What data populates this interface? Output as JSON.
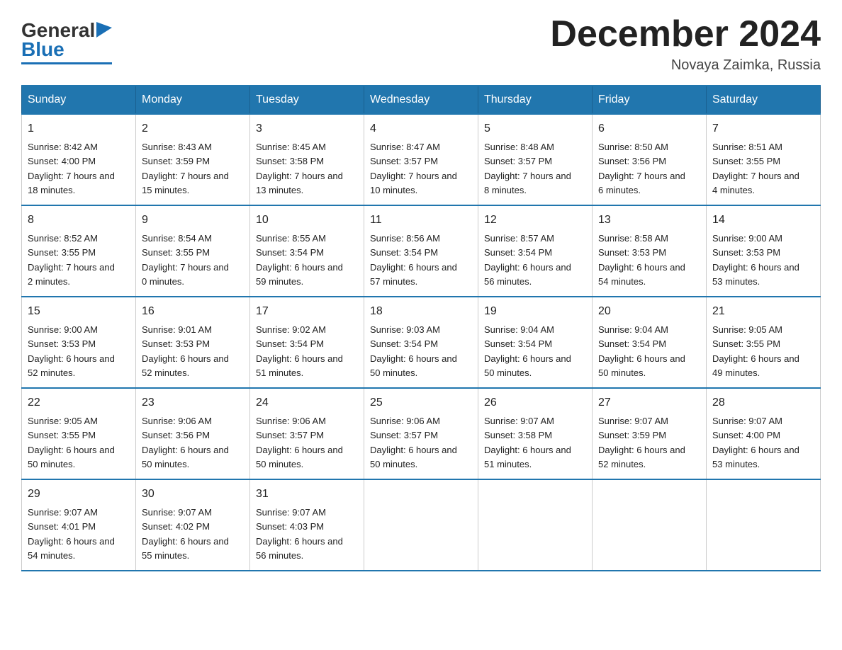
{
  "header": {
    "logo_text_general": "General",
    "logo_text_blue": "Blue",
    "month_title": "December 2024",
    "location": "Novaya Zaimka, Russia"
  },
  "days_of_week": [
    "Sunday",
    "Monday",
    "Tuesday",
    "Wednesday",
    "Thursday",
    "Friday",
    "Saturday"
  ],
  "weeks": [
    [
      {
        "day": "1",
        "sunrise": "8:42 AM",
        "sunset": "4:00 PM",
        "daylight": "7 hours and 18 minutes."
      },
      {
        "day": "2",
        "sunrise": "8:43 AM",
        "sunset": "3:59 PM",
        "daylight": "7 hours and 15 minutes."
      },
      {
        "day": "3",
        "sunrise": "8:45 AM",
        "sunset": "3:58 PM",
        "daylight": "7 hours and 13 minutes."
      },
      {
        "day": "4",
        "sunrise": "8:47 AM",
        "sunset": "3:57 PM",
        "daylight": "7 hours and 10 minutes."
      },
      {
        "day": "5",
        "sunrise": "8:48 AM",
        "sunset": "3:57 PM",
        "daylight": "7 hours and 8 minutes."
      },
      {
        "day": "6",
        "sunrise": "8:50 AM",
        "sunset": "3:56 PM",
        "daylight": "7 hours and 6 minutes."
      },
      {
        "day": "7",
        "sunrise": "8:51 AM",
        "sunset": "3:55 PM",
        "daylight": "7 hours and 4 minutes."
      }
    ],
    [
      {
        "day": "8",
        "sunrise": "8:52 AM",
        "sunset": "3:55 PM",
        "daylight": "7 hours and 2 minutes."
      },
      {
        "day": "9",
        "sunrise": "8:54 AM",
        "sunset": "3:55 PM",
        "daylight": "7 hours and 0 minutes."
      },
      {
        "day": "10",
        "sunrise": "8:55 AM",
        "sunset": "3:54 PM",
        "daylight": "6 hours and 59 minutes."
      },
      {
        "day": "11",
        "sunrise": "8:56 AM",
        "sunset": "3:54 PM",
        "daylight": "6 hours and 57 minutes."
      },
      {
        "day": "12",
        "sunrise": "8:57 AM",
        "sunset": "3:54 PM",
        "daylight": "6 hours and 56 minutes."
      },
      {
        "day": "13",
        "sunrise": "8:58 AM",
        "sunset": "3:53 PM",
        "daylight": "6 hours and 54 minutes."
      },
      {
        "day": "14",
        "sunrise": "9:00 AM",
        "sunset": "3:53 PM",
        "daylight": "6 hours and 53 minutes."
      }
    ],
    [
      {
        "day": "15",
        "sunrise": "9:00 AM",
        "sunset": "3:53 PM",
        "daylight": "6 hours and 52 minutes."
      },
      {
        "day": "16",
        "sunrise": "9:01 AM",
        "sunset": "3:53 PM",
        "daylight": "6 hours and 52 minutes."
      },
      {
        "day": "17",
        "sunrise": "9:02 AM",
        "sunset": "3:54 PM",
        "daylight": "6 hours and 51 minutes."
      },
      {
        "day": "18",
        "sunrise": "9:03 AM",
        "sunset": "3:54 PM",
        "daylight": "6 hours and 50 minutes."
      },
      {
        "day": "19",
        "sunrise": "9:04 AM",
        "sunset": "3:54 PM",
        "daylight": "6 hours and 50 minutes."
      },
      {
        "day": "20",
        "sunrise": "9:04 AM",
        "sunset": "3:54 PM",
        "daylight": "6 hours and 50 minutes."
      },
      {
        "day": "21",
        "sunrise": "9:05 AM",
        "sunset": "3:55 PM",
        "daylight": "6 hours and 49 minutes."
      }
    ],
    [
      {
        "day": "22",
        "sunrise": "9:05 AM",
        "sunset": "3:55 PM",
        "daylight": "6 hours and 50 minutes."
      },
      {
        "day": "23",
        "sunrise": "9:06 AM",
        "sunset": "3:56 PM",
        "daylight": "6 hours and 50 minutes."
      },
      {
        "day": "24",
        "sunrise": "9:06 AM",
        "sunset": "3:57 PM",
        "daylight": "6 hours and 50 minutes."
      },
      {
        "day": "25",
        "sunrise": "9:06 AM",
        "sunset": "3:57 PM",
        "daylight": "6 hours and 50 minutes."
      },
      {
        "day": "26",
        "sunrise": "9:07 AM",
        "sunset": "3:58 PM",
        "daylight": "6 hours and 51 minutes."
      },
      {
        "day": "27",
        "sunrise": "9:07 AM",
        "sunset": "3:59 PM",
        "daylight": "6 hours and 52 minutes."
      },
      {
        "day": "28",
        "sunrise": "9:07 AM",
        "sunset": "4:00 PM",
        "daylight": "6 hours and 53 minutes."
      }
    ],
    [
      {
        "day": "29",
        "sunrise": "9:07 AM",
        "sunset": "4:01 PM",
        "daylight": "6 hours and 54 minutes."
      },
      {
        "day": "30",
        "sunrise": "9:07 AM",
        "sunset": "4:02 PM",
        "daylight": "6 hours and 55 minutes."
      },
      {
        "day": "31",
        "sunrise": "9:07 AM",
        "sunset": "4:03 PM",
        "daylight": "6 hours and 56 minutes."
      },
      null,
      null,
      null,
      null
    ]
  ],
  "labels": {
    "sunrise": "Sunrise:",
    "sunset": "Sunset:",
    "daylight": "Daylight:"
  }
}
